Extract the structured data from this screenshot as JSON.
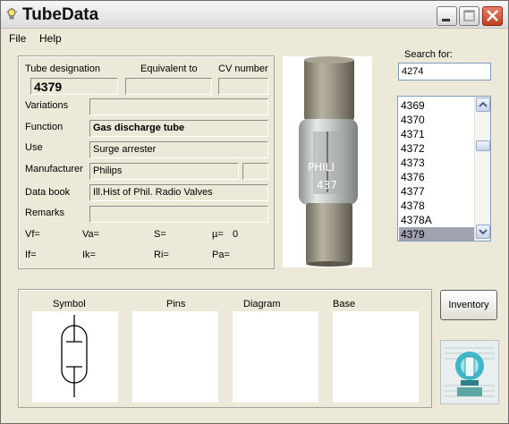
{
  "window": {
    "title": "TubeData"
  },
  "menu": {
    "file": "File",
    "help": "Help"
  },
  "tube": {
    "designation_label": "Tube designation",
    "designation": "4379",
    "equivalent_label": "Equivalent to",
    "equivalent": "",
    "cv_label": "CV number",
    "cv": "",
    "variations_label": "Variations",
    "variations": "",
    "function_label": "Function",
    "function": "Gas discharge tube",
    "use_label": "Use",
    "use": "Surge arrester",
    "manufacturer_label": "Manufacturer",
    "manufacturer": "Philips",
    "manufacturer_extra": "",
    "databook_label": "Data book",
    "databook": "Ill.Hist of Phil. Radio Valves",
    "remarks_label": "Remarks",
    "remarks": "",
    "params": {
      "vf": "Vf=",
      "va": "Va=",
      "s": "S=",
      "mu": "µ=",
      "mu_value": "0",
      "if": "If=",
      "ik": "Ik=",
      "ri": "Ri=",
      "pa": "Pa="
    }
  },
  "photo": {
    "print_1": "PHILI",
    "print_2": "437"
  },
  "search": {
    "label": "Search for:",
    "value": "4274",
    "list": [
      "4369",
      "4370",
      "4371",
      "4372",
      "4373",
      "4376",
      "4377",
      "4378",
      "4378A",
      "4379"
    ],
    "selected": "4379"
  },
  "panels": {
    "symbol": "Symbol",
    "pins": "Pins",
    "diagram": "Diagram",
    "base": "Base"
  },
  "inventory_button": "Inventory",
  "colors": {
    "selection": "#9fa2b0",
    "window_bg": "#ece9d8",
    "close_button": "#c1401f"
  },
  "icons": [
    "lightbulb-icon",
    "minimize-icon",
    "maximize-icon",
    "close-icon",
    "scroll-up-icon",
    "scroll-down-icon",
    "tube-logo-icon"
  ]
}
